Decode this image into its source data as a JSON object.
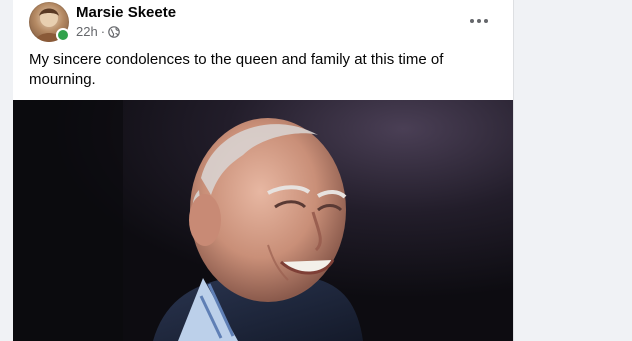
{
  "post": {
    "author": "Marsie Skeete",
    "timestamp": "22h",
    "separator": "·",
    "audience_icon": "globe-icon",
    "text": "My sincere condolences to the queen and family at this time of mourning.",
    "more_icon": "more-options-icon"
  },
  "colors": {
    "online_status": "#31a24c",
    "name_text": "#050505",
    "meta_text": "#65676b",
    "page_background": "#f0f2f5"
  }
}
